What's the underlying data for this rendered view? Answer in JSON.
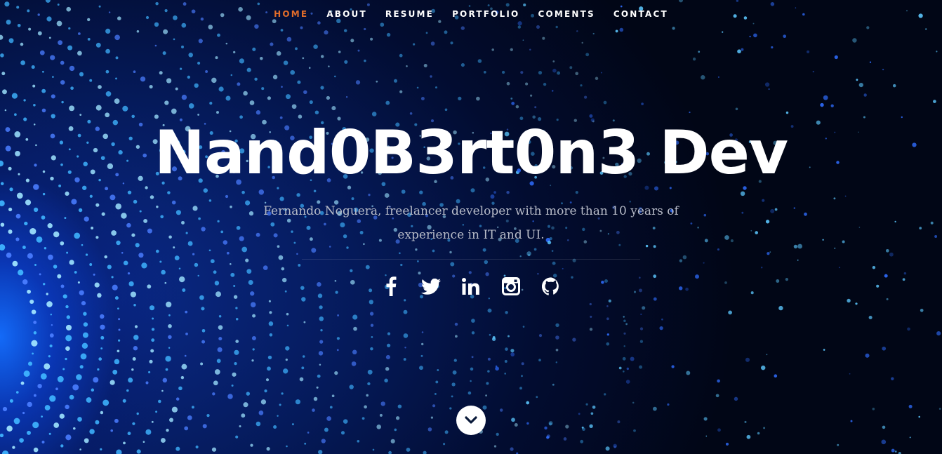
{
  "nav": {
    "items": [
      {
        "label": "HOME",
        "active": true
      },
      {
        "label": "ABOUT",
        "active": false
      },
      {
        "label": "RESUME",
        "active": false
      },
      {
        "label": "PORTFOLIO",
        "active": false
      },
      {
        "label": "COMENTS",
        "active": false
      },
      {
        "label": "CONTACT",
        "active": false
      }
    ]
  },
  "hero": {
    "title": "Nand0B3rt0n3 Dev",
    "subtitle": "Fernando Noguera, freelancer developer with more than 10 years of experience in IT and UI."
  },
  "social": [
    {
      "icon": "facebook-icon"
    },
    {
      "icon": "twitter-icon"
    },
    {
      "icon": "linkedin-icon"
    },
    {
      "icon": "instagram-icon"
    },
    {
      "icon": "github-icon"
    }
  ],
  "scroll": {
    "icon": "chevron-down-icon"
  },
  "colors": {
    "accent": "#e16c2a",
    "text": "#ffffff",
    "subtitle": "#b8bcc8",
    "background": "#020a1f"
  }
}
